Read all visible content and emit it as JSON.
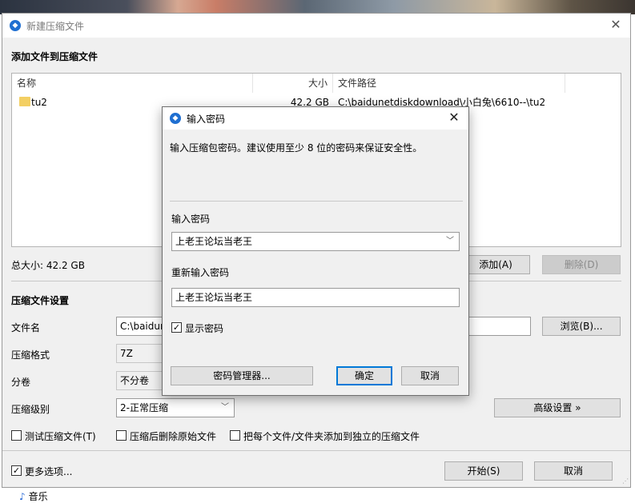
{
  "window": {
    "title": "新建压缩文件",
    "section_add_files": "添加文件到压缩文件",
    "columns": {
      "name": "名称",
      "size": "大小",
      "path": "文件路径"
    },
    "files": [
      {
        "name": "tu2",
        "size": "42.2 GB",
        "path": "C:\\baidunetdiskdownload\\小白兔\\6610--\\tu2"
      }
    ],
    "total_size": "总大小: 42.2 GB",
    "add_button": "添加(A)",
    "delete_button": "删除(D)",
    "settings_title": "压缩文件设置",
    "filename_label": "文件名",
    "filename_value": "C:\\baidur",
    "browse_button": "浏览(B)...",
    "format_label": "压缩格式",
    "format_value": "7Z",
    "split_label": "分卷",
    "split_value": "不分卷",
    "level_label": "压缩级别",
    "level_value": "2-正常压缩",
    "advanced_button": "高级设置 »",
    "test_checkbox": "测试压缩文件(T)",
    "delete_after_checkbox": "压缩后删除原始文件",
    "separate_checkbox": "把每个文件/文件夹添加到独立的压缩文件",
    "more_options_checkbox": "更多选项...",
    "start_button": "开始(S)",
    "cancel_button": "取消"
  },
  "dialog": {
    "title": "输入密码",
    "hint": "输入压缩包密码。建议使用至少 8 位的密码来保证安全性。",
    "password_label": "输入密码",
    "password_value": "上老王论坛当老王",
    "repeat_label": "重新输入密码",
    "repeat_value": "上老王论坛当老王",
    "show_password": "显示密码",
    "manager_button": "密码管理器...",
    "ok_button": "确定",
    "cancel_button": "取消"
  },
  "desktop": {
    "music_label": "音乐"
  },
  "icons": {
    "app": "app-logo-icon",
    "close": "close-icon",
    "folder": "folder-icon",
    "dropdown": "chevron-down-icon",
    "check": "checkmark-icon",
    "music": "music-note-icon"
  }
}
